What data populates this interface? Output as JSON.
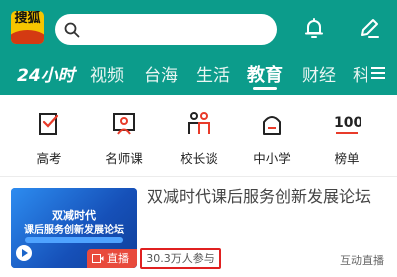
{
  "header": {
    "logo_text": "搜狐",
    "search": {
      "placeholder": ""
    },
    "icons": [
      "bell-icon",
      "pencil-icon",
      "menu-icon"
    ]
  },
  "tabs": [
    {
      "label": "24小时",
      "active": false
    },
    {
      "label": "视频",
      "active": false
    },
    {
      "label": "台海",
      "active": false
    },
    {
      "label": "生活",
      "active": false
    },
    {
      "label": "教育",
      "active": true
    },
    {
      "label": "财经",
      "active": false
    },
    {
      "label": "科",
      "active": false
    }
  ],
  "categories": [
    {
      "label": "高考",
      "icon": "book-check-icon"
    },
    {
      "label": "名师课",
      "icon": "teacher-board-icon"
    },
    {
      "label": "校长谈",
      "icon": "people-icon"
    },
    {
      "label": "中小学",
      "icon": "school-bag-icon"
    },
    {
      "label": "榜单",
      "icon": "ranking-100-icon"
    }
  ],
  "feed": [
    {
      "title": "双减时代课后服务创新发展论坛",
      "thumbnail": {
        "line1": "双减时代",
        "line2": "课后服务创新发展论坛",
        "live_badge": "直播"
      },
      "views": "30.3万人参与",
      "source": "互动直播"
    }
  ],
  "colors": {
    "brand": "#0c9c8b",
    "live_badge": "#e84a3c",
    "highlight_box": "#e02020"
  }
}
